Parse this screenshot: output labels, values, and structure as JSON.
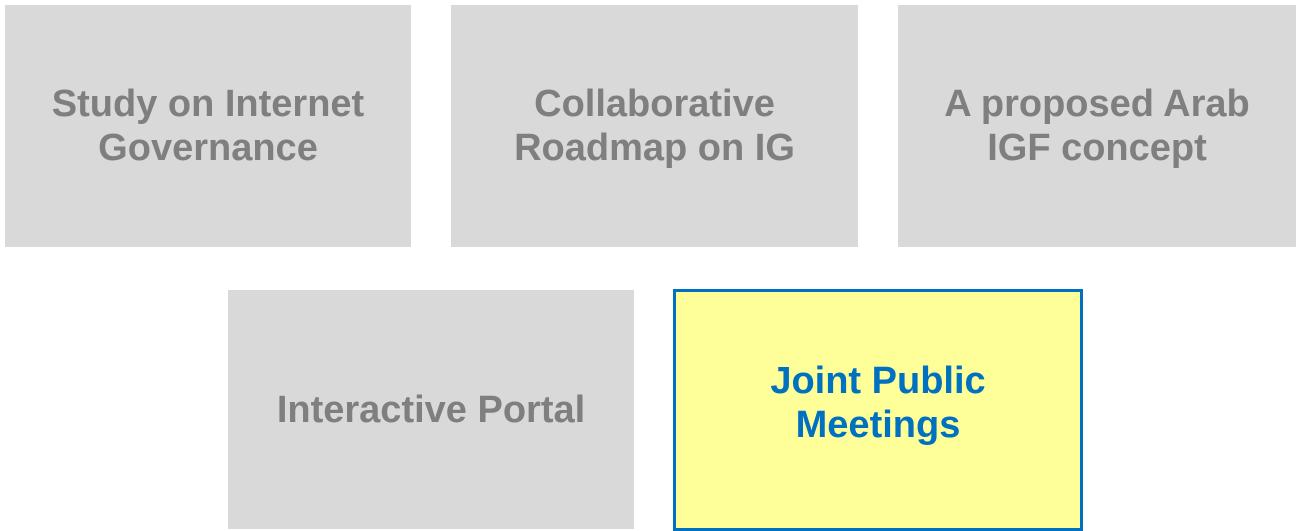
{
  "tiles": [
    {
      "id": "study",
      "label": "Study on Internet Governance",
      "state": "inactive"
    },
    {
      "id": "roadmap",
      "label": "Collaborative Roadmap on IG",
      "state": "inactive"
    },
    {
      "id": "arab",
      "label": "A proposed Arab IGF concept",
      "state": "inactive"
    },
    {
      "id": "portal",
      "label": "Interactive Portal",
      "state": "inactive"
    },
    {
      "id": "joint",
      "label": "Joint Public Meetings",
      "state": "active"
    }
  ],
  "colors": {
    "inactive_fill": "#d9d9d9",
    "inactive_text": "#7f7f7f",
    "active_fill": "#ffff99",
    "active_text": "#0070c0",
    "active_border": "#0070c0"
  }
}
